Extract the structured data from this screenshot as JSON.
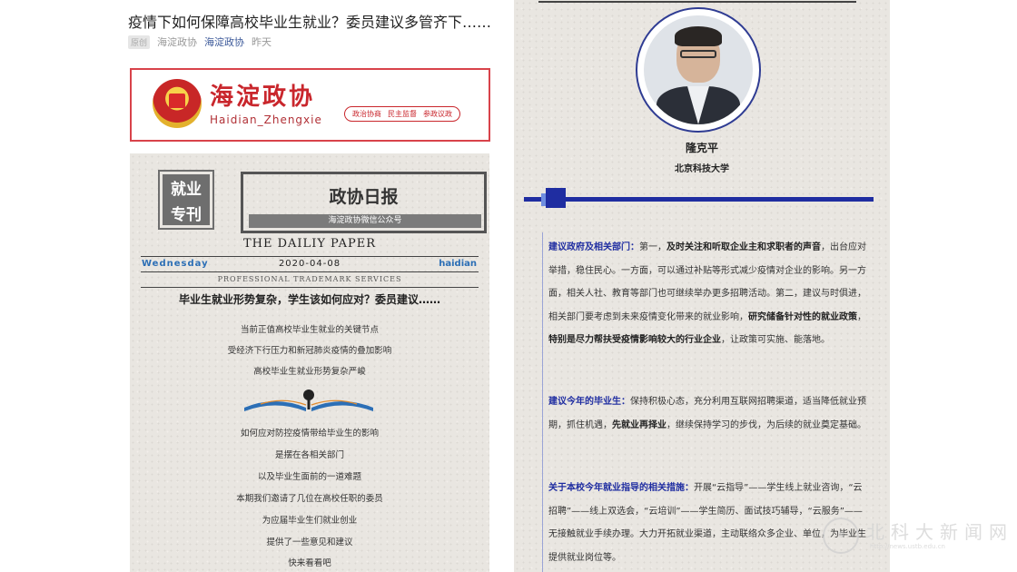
{
  "article": {
    "title": "疫情下如何保障高校毕业生就业？委员建议多管齐下……",
    "tag": "原创",
    "author": "海淀政协",
    "account": "海淀政协",
    "time": "昨天"
  },
  "banner": {
    "name_cn": "海淀政协",
    "name_en": "Haidian_Zhengxie",
    "tags": [
      "政治协商",
      "民主监督",
      "参政议政"
    ]
  },
  "paper": {
    "badge_line1": "就业",
    "badge_line2": "专刊",
    "title": "政协日报",
    "subtitle": "海淀政协微信公众号",
    "en_title": "THE DAILIY PAPER",
    "weekday": "Wednesday",
    "date": "2020-04-08",
    "location": "haidian",
    "trademark": "PROFESSIONAL TRADEMARK SERVICES",
    "headline": "毕业生就业形势复杂，学生该如何应对？委员建议……",
    "intro": [
      "当前正值高校毕业生就业的关键节点",
      "受经济下行压力和新冠肺炎疫情的叠加影响",
      "高校毕业生就业形势复杂严峻"
    ],
    "outro": [
      "如何应对防控疫情带给毕业生的影响",
      "是摆在各相关部门",
      "以及毕业生面前的一道难题",
      "本期我们邀请了几位在高校任职的委员",
      "为应届毕业生们就业创业",
      "提供了一些意见和建议",
      "快来看看吧"
    ]
  },
  "profile": {
    "name": "隆克平",
    "org": "北京科技大学"
  },
  "sections": {
    "s1_lead": "建议政府及相关部门：",
    "s1_a": "第一，",
    "s1_b": "及时关注和听取企业主和求职者的声音",
    "s1_c": "，出台应对举措，稳住民心。一方面，可以通过补贴等形式减少疫情对企业的影响。另一方面，相关人社、教育等部门也可继续举办更多招聘活动。第二，建议与时俱进，相关部门要考虑到未来疫情变化带来的就业影响，",
    "s1_d": "研究储备针对性的就业政策",
    "s1_e": "，",
    "s1_f": "特别是尽力帮扶受疫情影响较大的行业企业",
    "s1_g": "，让政策可实施、能落地。",
    "s2_lead": "建议今年的毕业生：",
    "s2_a": "保持积极心态，充分利用互联网招聘渠道，适当降低就业预期，抓住机遇，",
    "s2_b": "先就业再择业",
    "s2_c": "，继续保持学习的步伐，为后续的就业奠定基础。",
    "s3_lead": "关于本校今年就业指导的相关措施：",
    "s3_a": "开展“云指导”——学生线上就业咨询，“云招聘”——线上双选会，“云培训”——学生简历、面试技巧辅导，“云服务”——无接触就业手续办理。大力开拓就业渠道，主动联络众多企业、单位，为毕业生提供就业岗位等。"
  },
  "watermark": {
    "text": "北科大新闻网",
    "url": "http://news.ustb.edu.cn"
  },
  "colors": {
    "accent_blue": "#1f2da1",
    "banner_red": "#c9262c",
    "link_blue": "#3d5a9a"
  }
}
